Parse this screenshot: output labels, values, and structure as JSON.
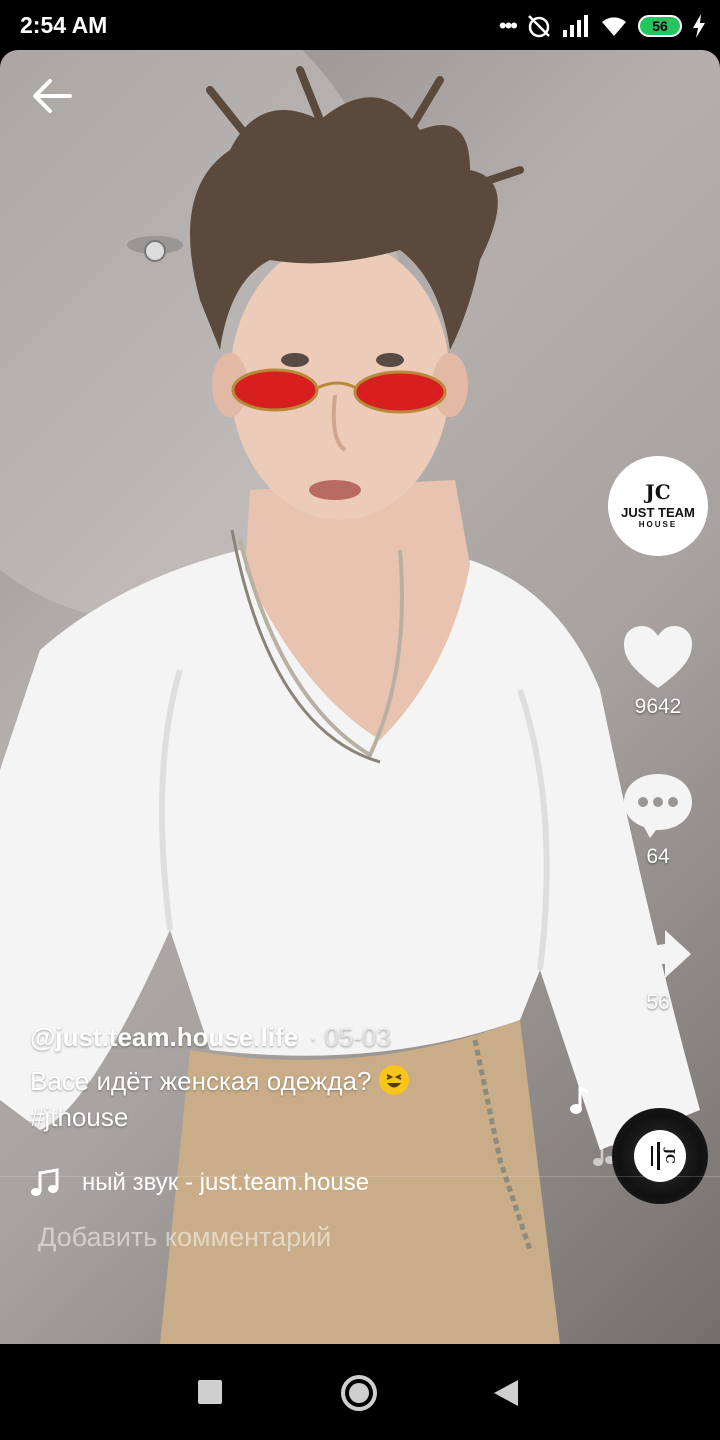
{
  "status_bar": {
    "time": "2:54 AM",
    "battery": "56"
  },
  "profile": {
    "logo_text": "JC",
    "name_line1": "JUST TEAM",
    "name_line2": "HOUSE"
  },
  "actions": {
    "likes_count": "9642",
    "comments_count": "64",
    "shares_count": "56"
  },
  "post": {
    "username": "@just.team.house.life",
    "date": "· 05-03",
    "description": "Васе идёт женская одежда?",
    "hashtag": "#jthouse",
    "sound": "ный звук - just.team.house"
  },
  "comment": {
    "placeholder": "Добавить комментарий"
  },
  "icons": {
    "back": "arrow-left-icon",
    "like": "heart-icon",
    "comment": "comment-bubble-icon",
    "share": "share-arrow-icon",
    "sound": "music-note-icon",
    "nav": [
      "square-icon",
      "circle-icon",
      "triangle-back-icon"
    ]
  },
  "colors": {
    "accent_battery": "#22c55e",
    "emoji": "#f8c51c",
    "glasses": "#d81f1f"
  }
}
